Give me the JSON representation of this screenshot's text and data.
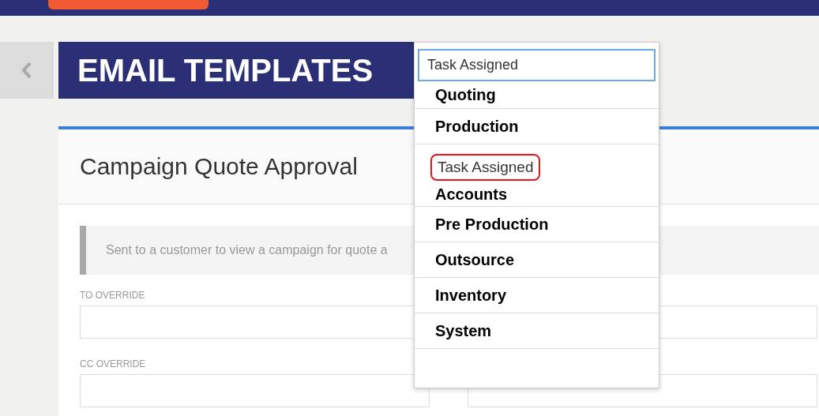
{
  "page_title": "EMAIL TEMPLATES",
  "card": {
    "title": "Campaign Quote Approval",
    "description": "Sent to a customer to view a campaign for quote a",
    "fields": [
      {
        "label": "TO OVERRIDE"
      },
      {
        "label": "CC OVERRIDE"
      }
    ]
  },
  "dropdown": {
    "search_value": "Task Assigned",
    "items": [
      {
        "label": "Quoting",
        "kind": "group",
        "highlighted": false
      },
      {
        "label": "Production",
        "kind": "group",
        "highlighted": false
      },
      {
        "label": "Task Assigned",
        "kind": "option",
        "highlighted": true
      },
      {
        "label": "Accounts",
        "kind": "group",
        "highlighted": false
      },
      {
        "label": "Pre Production",
        "kind": "group",
        "highlighted": false
      },
      {
        "label": "Outsource",
        "kind": "group",
        "highlighted": false
      },
      {
        "label": "Inventory",
        "kind": "group",
        "highlighted": false
      },
      {
        "label": "System",
        "kind": "group",
        "highlighted": false
      }
    ]
  }
}
